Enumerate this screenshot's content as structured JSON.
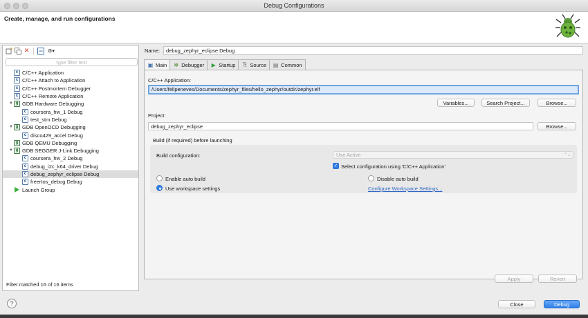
{
  "window": {
    "title": "Debug Configurations"
  },
  "header": {
    "title": "Create, manage, and run configurations",
    "logo_icon": "bug-icon"
  },
  "left": {
    "toolbar_icons": [
      "new-config-icon",
      "duplicate-icon",
      "delete-icon",
      "collapse-all-icon",
      "filter-icon"
    ],
    "filter_placeholder": "type filter text",
    "tree": [
      {
        "label": "C/C++ Application",
        "depth": 1,
        "icon": "c",
        "expanded": null
      },
      {
        "label": "C/C++ Attach to Application",
        "depth": 1,
        "icon": "c",
        "expanded": null
      },
      {
        "label": "C/C++ Postmortem Debugger",
        "depth": 1,
        "icon": "c",
        "expanded": null
      },
      {
        "label": "C/C++ Remote Application",
        "depth": 1,
        "icon": "c",
        "expanded": null
      },
      {
        "label": "GDB Hardware Debugging",
        "depth": 1,
        "icon": "g",
        "expanded": true
      },
      {
        "label": "coursera_hw_1 Debug",
        "depth": 2,
        "icon": "c",
        "expanded": null
      },
      {
        "label": "test_stm Debug",
        "depth": 2,
        "icon": "c",
        "expanded": null
      },
      {
        "label": "GDB OpenOCD Debugging",
        "depth": 1,
        "icon": "g",
        "expanded": true
      },
      {
        "label": "disco429_accel Debug",
        "depth": 2,
        "icon": "c",
        "expanded": null
      },
      {
        "label": "GDB QEMU Debugging",
        "depth": 1,
        "icon": "g",
        "expanded": null
      },
      {
        "label": "GDB SEGGER J-Link Debugging",
        "depth": 1,
        "icon": "g",
        "expanded": true
      },
      {
        "label": "coursera_hw_2 Debug",
        "depth": 2,
        "icon": "c",
        "expanded": null
      },
      {
        "label": "debug_i2c_k64_driver Debug",
        "depth": 2,
        "icon": "c",
        "expanded": null
      },
      {
        "label": "debug_zephyr_eclipse Debug",
        "depth": 2,
        "icon": "c",
        "expanded": null,
        "selected": true
      },
      {
        "label": "freertos_debug Debug",
        "depth": 2,
        "icon": "c",
        "expanded": null
      },
      {
        "label": "Launch Group",
        "depth": 1,
        "icon": "play",
        "expanded": null
      }
    ],
    "filter_status": "Filter matched 16 of 16 items"
  },
  "right": {
    "name_label": "Name:",
    "name_value": "debug_zephyr_eclipse Debug",
    "tabs": [
      {
        "label": "Main",
        "icon": "main-icon",
        "active": true
      },
      {
        "label": "Debugger",
        "icon": "debugger-icon",
        "active": false
      },
      {
        "label": "Startup",
        "icon": "startup-icon",
        "active": false
      },
      {
        "label": "Source",
        "icon": "source-icon",
        "active": false
      },
      {
        "label": "Common",
        "icon": "common-icon",
        "active": false
      }
    ],
    "main": {
      "app_label": "C/C++ Application:",
      "app_value": "/Users/felipeneves/Documents/zephyr_files/hello_zephyr/outdir/zephyr.elf",
      "variables_btn": "Variables...",
      "search_project_btn": "Search Project...",
      "browse_btn_1": "Browse...",
      "project_label": "Project:",
      "project_value": "debug_zephyr_eclipse",
      "browse_btn_2": "Browse...",
      "build_section_label": "Build (if required) before launching",
      "build_config_label": "Build configuration:",
      "build_config_value": "Use Active",
      "select_config_label": "Select configuration using 'C/C++ Application'",
      "enable_auto_label": "Enable auto build",
      "disable_auto_label": "Disable auto build",
      "workspace_label": "Use workspace settings",
      "configure_link": "Configure Workspace Settings..."
    },
    "apply_btn": "Apply",
    "revert_btn": "Revert"
  },
  "footer": {
    "close_btn": "Close",
    "debug_btn": "Debug",
    "help_label": "?"
  },
  "colors": {
    "accent": "#2f7fe8",
    "selection": "#dcdcdc",
    "link": "#2a64c4"
  }
}
